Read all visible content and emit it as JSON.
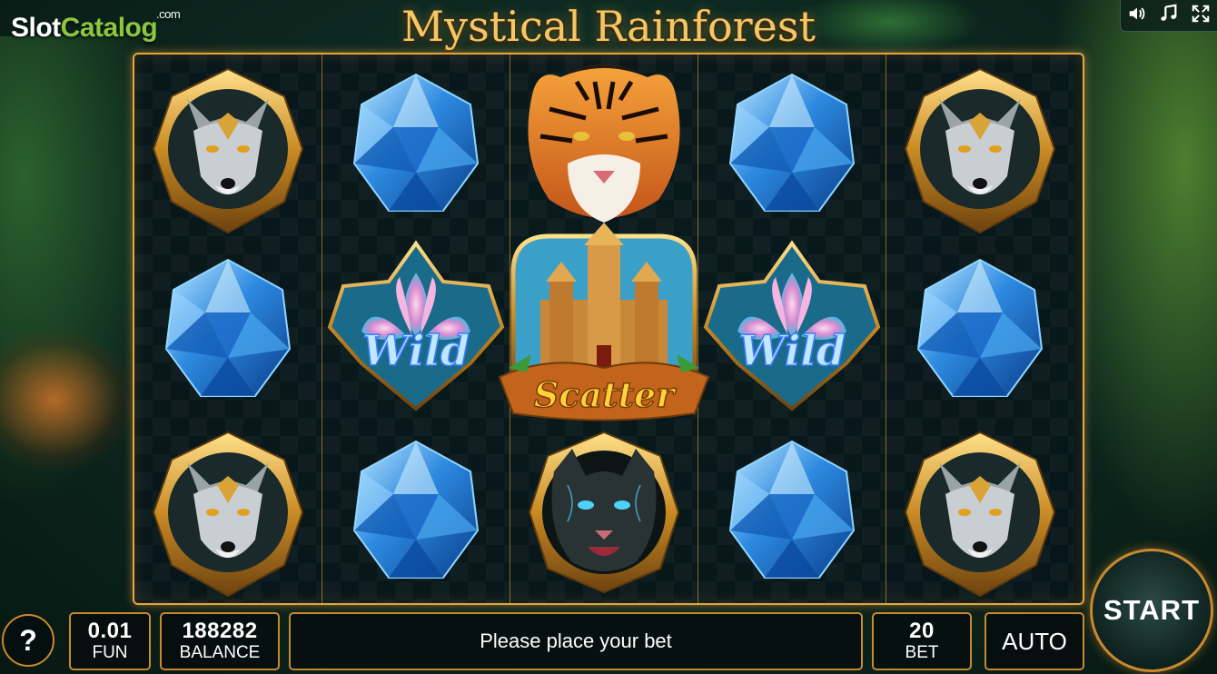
{
  "logo": {
    "part1": "Slot",
    "part2": "Catalog",
    "suffix": ".com"
  },
  "title": "Mystical Rainforest",
  "top_controls": [
    "sound-icon",
    "music-icon",
    "fullscreen-icon"
  ],
  "reels": [
    [
      "wolf",
      "gem",
      "wolf"
    ],
    [
      "gem",
      "wild",
      "gem"
    ],
    [
      "tiger",
      "scatter",
      "panther"
    ],
    [
      "gem",
      "wild",
      "gem"
    ],
    [
      "wolf",
      "gem",
      "wolf"
    ]
  ],
  "symbols": {
    "wild_label": "Wild",
    "scatter_label": "Scatter"
  },
  "bottom": {
    "help": "?",
    "coin_value": "0.01",
    "currency": "FUN",
    "balance_value": "188282",
    "balance_label": "BALANCE",
    "message": "Please place your bet",
    "bet_value": "20",
    "bet_label": "BET",
    "auto_label": "AUTO",
    "start_label": "START"
  },
  "colors": {
    "frame_gold": "#e6a63a",
    "logo_green": "#8cc63f",
    "gem_blue": "#2d8ae0"
  }
}
